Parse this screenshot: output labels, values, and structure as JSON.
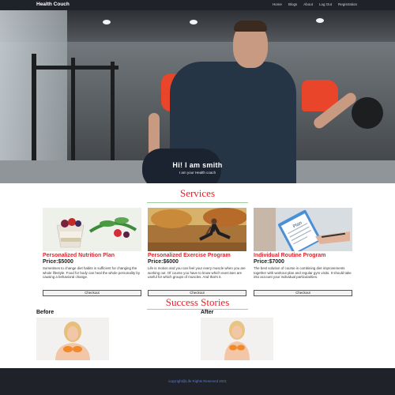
{
  "navbar": {
    "brand": "Health Couch",
    "links": [
      "Home",
      "Blogs",
      "About",
      "Log Out",
      "Registration"
    ]
  },
  "hero": {
    "title": "Hi! I am smith",
    "subtitle": "I am your Health coach"
  },
  "services": {
    "heading": "Services",
    "cards": [
      {
        "name": "Personalized Nutrition Plan",
        "price": "Price:$5000",
        "description": "Sometimes to change diet habits is sufficient for changing the whole lifestyle. Food for body can heal the whole personality by causing a behavioral change.",
        "button": "Checkout",
        "image_icon": "nutrition-bowl"
      },
      {
        "name": "Personalized Exercise Program",
        "price": "Price:$6000",
        "description": "Life is motion and you can feel your every muscle when you are working out. Of course you have to know which exercises are useful for which groups of muscles. And that's it.",
        "button": "Checkout",
        "image_icon": "exercise-woman"
      },
      {
        "name": "Individual Routine Program",
        "price": "Price:$7000",
        "description": "The best solution of course is combining diet improvements together with workout plan and regular gym visits. It should take into account your individual particularities.",
        "button": "Checkout",
        "image_icon": "clipboard-plan",
        "image_text": "Plan"
      }
    ]
  },
  "success": {
    "heading": "Success Stories",
    "before_label": "Before",
    "after_label": "After"
  },
  "footer": {
    "text": "copyright@Life Rights Reserved 2021"
  },
  "colors": {
    "accent": "#e0262e",
    "nav_bg": "#1f2329",
    "footer_link": "#4f7de3",
    "divider": "#9ccf9c"
  }
}
